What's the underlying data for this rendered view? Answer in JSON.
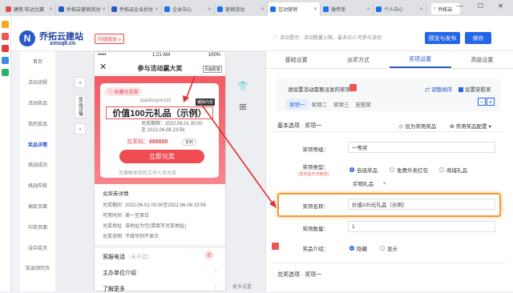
{
  "browser": {
    "tabs": [
      {
        "label": "建筑·粒达比赛",
        "color": "#e14b4b"
      },
      {
        "label": "乔拓云营销活动",
        "color": "#2a58c9"
      },
      {
        "label": "乔拓云企业后台",
        "color": "#2a58c9"
      },
      {
        "label": "企业中心",
        "color": "#1a73e8"
      },
      {
        "label": "营销活动",
        "color": "#1a73e8"
      },
      {
        "label": "互动营销",
        "color": "#1a73e8"
      },
      {
        "label": "微传单",
        "color": "#1a73e8"
      },
      {
        "label": "个人中心",
        "color": "#1a73e8"
      }
    ],
    "search_text": "乔拓云",
    "window_controls": "— ☐ ✕"
  },
  "header": {
    "logo_glyph": "N",
    "brand": "乔拓云建站",
    "url": "xmsq6.cn",
    "upgrade_badge": "升级版本 »",
    "notice": "活动提示：活动数量上限，最多20人可参与活动",
    "preview_publish": "预览与发布",
    "save": "保存"
  },
  "sidebar": {
    "items": [
      {
        "label": "首页"
      },
      {
        "label": "活动流程"
      },
      {
        "label": "活动奖品"
      },
      {
        "label": "我的奖品"
      },
      {
        "label": "奖品详情",
        "active": true
      },
      {
        "label": "挑战成功"
      },
      {
        "label": "挑战失败"
      },
      {
        "label": "抽奖页面"
      },
      {
        "label": "中奖页面"
      },
      {
        "label": "没中奖页"
      },
      {
        "label": "奖品领完页"
      }
    ]
  },
  "tools": {
    "up": "∧",
    "vertical_tab": "奖品详情",
    "down": "∨",
    "shirt_icon": "👕",
    "grid_icon": "⊞",
    "side_label": "更多设置"
  },
  "phone": {
    "carrier": "•••••",
    "time": "1:21 AM",
    "battery": "100%",
    "close": "✕",
    "title": "参与活动赢大奖",
    "page_tag": "页面配置",
    "collect": "♡ 收藏兑奖券",
    "account": "qiaotuoyun111",
    "account_tag": "编辑内容",
    "prize": "价值100元礼品（示例）",
    "period_line1": "兑奖期限：2022.06.01 00:00",
    "period_line2": "至 2022.06.08 23:59",
    "code_label": "兑奖码：",
    "code_value": "888888",
    "copy": "复制",
    "redeem_button": "立即兑奖",
    "help": "兑换联系你的工作人员兑奖",
    "detail_title": "兑奖券详情",
    "details": [
      {
        "k": "兑奖期间",
        "v": "2022-06-01 00:00至2022-06-08 23:59"
      },
      {
        "k": "可用时间",
        "v": "周一至周日"
      },
      {
        "k": "兑奖地址",
        "v": "该地址为空(请填写兑奖地址)"
      },
      {
        "k": "兑奖说明",
        "v": "不填写则不显示"
      }
    ],
    "service_label": "客服电话",
    "service_value": "（未开启）",
    "phone_icon": "✆",
    "rows": [
      {
        "label": "主办单位介绍"
      },
      {
        "label": "了解更多"
      }
    ],
    "arrow": "›"
  },
  "right": {
    "tabs": [
      {
        "label": "基础设置"
      },
      {
        "label": "派奖方式"
      },
      {
        "label": "奖项设置",
        "active": true
      },
      {
        "label": "高级设置"
      }
    ],
    "set_title": "请设置活动需要派发的奖项",
    "adjust_order": "⇄ 调整顺序",
    "safe_stock": "设置安慰奖",
    "levels": [
      {
        "label": "奖项一",
        "active": true
      },
      {
        "label": "奖项二"
      },
      {
        "label": "奖项三"
      },
      {
        "label": "安慰奖"
      }
    ],
    "minus": "−",
    "plus": "+",
    "section1": "基本选项 · 奖项一",
    "fav_prize": "☆ 设为常用奖品",
    "common_cfg": "⚙ 常用奖品配置 ▾",
    "fields": {
      "level_label": "奖项等级：",
      "level_value": "一等奖",
      "type_label": "奖项类型：",
      "type_note": "(发布后不可修改)",
      "type_options": [
        {
          "label": "自选奖品",
          "checked": true
        },
        {
          "label": "免费外卖红包",
          "checked": false
        },
        {
          "label": "商城礼品",
          "checked": false
        }
      ],
      "type_value": "实物礼品",
      "name_label": "奖项名称：",
      "name_value": "价值100元礼品（示例）",
      "qty_label": "奖项数量：",
      "qty_value": "1",
      "intro_label": "奖品介绍：",
      "intro_options": [
        {
          "label": "隐藏",
          "checked": true
        },
        {
          "label": "显示",
          "checked": false
        }
      ]
    },
    "section2": "兑奖选项 · 奖项一"
  }
}
